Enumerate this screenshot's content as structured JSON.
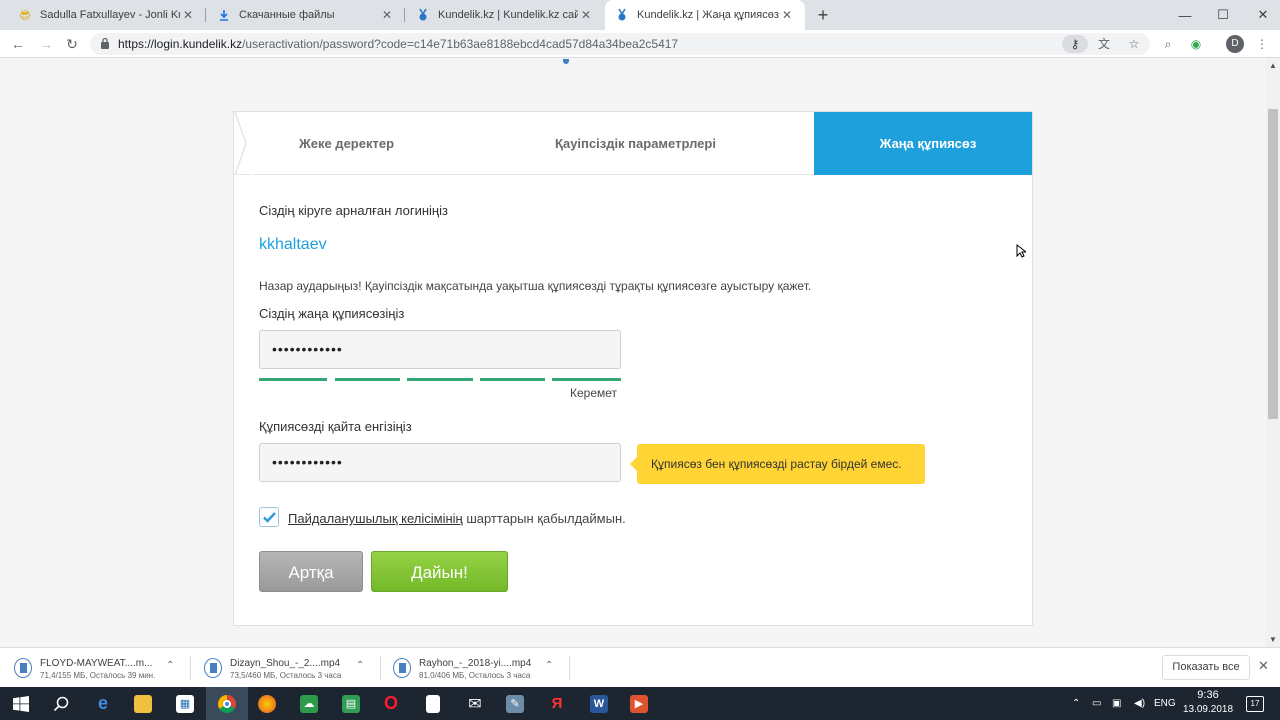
{
  "browser": {
    "tabs": [
      {
        "title": "Sadulla Fatxullayev - Jonli Kulgu",
        "favicon": "emoji-icon",
        "active": false
      },
      {
        "title": "Скачанные файлы",
        "favicon": "download-icon",
        "active": false
      },
      {
        "title": "Kundelik.kz | Kundelik.kz сайтына",
        "favicon": "kundelik-icon",
        "active": false
      },
      {
        "title": "Kundelik.kz | Жаңа құпиясөз",
        "favicon": "kundelik-icon",
        "active": true
      }
    ],
    "url_host": "https://login.kundelik.kz",
    "url_path": "/useractivation/password?code=c14e71b63ae8188ebcd4cad57d84a34bea2c5417",
    "profile_initial": "D"
  },
  "steps": [
    {
      "label": "Жеке деректер",
      "active": false
    },
    {
      "label": "Қауіпсіздік параметрлері",
      "active": false
    },
    {
      "label": "Жаңа құпиясөз",
      "active": true
    }
  ],
  "form": {
    "login_label": "Сіздің кіруге арналған логиніңіз",
    "login_value": "kkhaltaev",
    "notice": "Назар аударыңыз! Қауіпсіздік мақсатында уақытша құпиясөзді тұрақты құпиясөзге ауыстыру қажет.",
    "new_password_label": "Сіздің жаңа құпиясөзіңіз",
    "new_password_value": "••••••••••••",
    "strength_label": "Керемет",
    "strength_level": 5,
    "strength_color": "#35a776",
    "confirm_password_label": "Құпиясөзді қайта енгізіңіз",
    "confirm_password_value": "••••••••••••",
    "mismatch_tooltip": "Құпиясөз бен құпиясөзді растау бірдей емес.",
    "agreement_link": "Пайдаланушылық келісімінің",
    "agreement_rest": " шарттарын қабылдаймын.",
    "agreement_checked": true,
    "back_button": "Артқа",
    "done_button": "Дайын!"
  },
  "colors": {
    "accent": "#1ea0dc",
    "tooltip": "#ffd434",
    "done": "#7cc02f",
    "back": "#a8a8a8"
  },
  "downloads": [
    {
      "name": "FLOYD-MAYWEAT....m...",
      "status": "71,4/155 МБ, Осталось 39 мин."
    },
    {
      "name": "Dizayn_Shou_-_2....mp4",
      "status": "73,5/460 МБ, Осталось 3 часа"
    },
    {
      "name": "Rayhon_-_2018-yi....mp4",
      "status": "81,0/406 МБ, Осталось 3 часа"
    }
  ],
  "downloads_show_all": "Показать все",
  "taskbar": {
    "language": "ENG",
    "time": "9:36",
    "date": "13.09.2018",
    "notifications": "17"
  }
}
